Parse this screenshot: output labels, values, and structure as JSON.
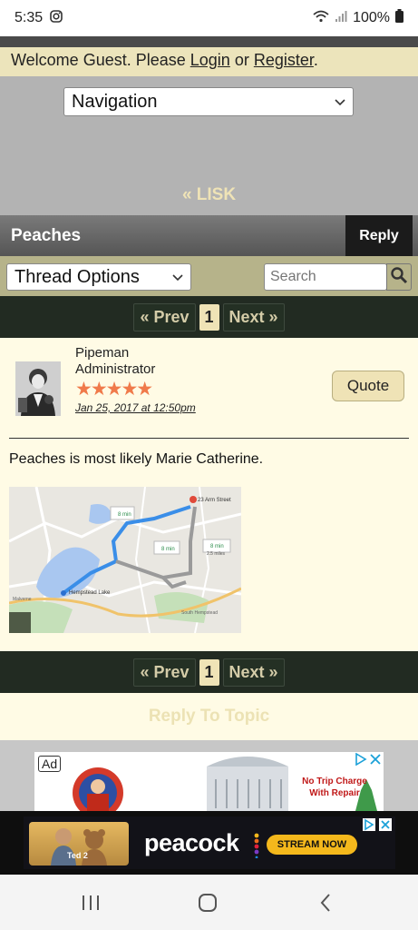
{
  "status": {
    "time": "5:35",
    "battery": "100%"
  },
  "header": {
    "welcome_text": "Welcome Guest. Please ",
    "login": "Login",
    "or": " or ",
    "register": "Register",
    "period": "."
  },
  "nav": {
    "select_value": "Navigation",
    "back_link": "« LISK"
  },
  "topic": {
    "title": "Peaches",
    "reply": "Reply"
  },
  "toolbar": {
    "thread_options": "Thread Options",
    "search_placeholder": "Search"
  },
  "pager": {
    "prev": "« Prev",
    "page": "1",
    "next": "Next »"
  },
  "post": {
    "author": "Pipeman",
    "role": "Administrator",
    "stars": "★★★★★",
    "rating": 5,
    "date": "Jan 25, 2017 at 12:50pm",
    "quote": "Quote",
    "text": "Peaches is most likely Marie Catherine.",
    "map": {
      "place1": "23 Arm Street",
      "place2": "Hempstead Lake",
      "time1": "8 min",
      "time2": "8 min",
      "time3": "8 min",
      "distance1": "2.5 miles",
      "area": "South Hempstead",
      "road": "Malverne"
    }
  },
  "footer": {
    "reply_to_topic": "Reply To Topic"
  },
  "ads": {
    "ad_label": "Ad",
    "ad1_text": "No Trip Charge With Repair",
    "ad2_caption": "Ted 2",
    "ad2_brand": "peacock",
    "ad2_cta": "STREAM NOW"
  },
  "colors": {
    "welcome_bg": "#ece4bb",
    "pager_bg": "#222b22",
    "post_bg": "#fffbe5",
    "accent": "#efe3b6",
    "star": "#f07a4a"
  }
}
